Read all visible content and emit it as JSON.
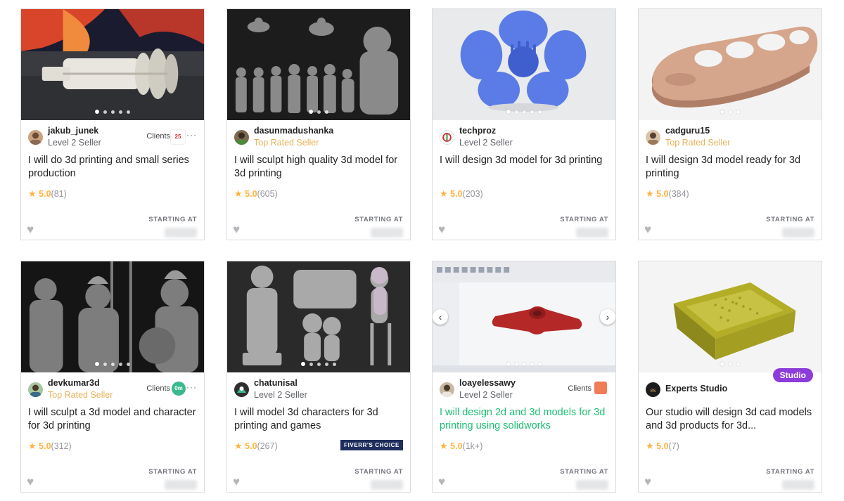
{
  "gigs": [
    {
      "seller": "jakub_junek",
      "level": "Level 2 Seller",
      "level_type": "regular",
      "clients_label": "Clients",
      "client_logo": "25",
      "title": "I will do 3d printing and small series production",
      "score": "5.0",
      "count": "(81)",
      "starting": "STARTING AT",
      "image": "jet-engine-model",
      "dots": 5
    },
    {
      "seller": "dasunmadushanka",
      "level": "Top Rated Seller",
      "level_type": "top",
      "title": "I will sculpt high quality 3d model for 3d printing",
      "score": "5.0",
      "count": "(605)",
      "starting": "STARTING AT",
      "image": "superhero-figurines",
      "dots": 3
    },
    {
      "seller": "techproz",
      "level": "Level 2 Seller",
      "level_type": "regular",
      "title": "I will design 3d model for 3d printing",
      "score": "5.0",
      "count": "(203)",
      "starting": "STARTING AT",
      "image": "blue-flower-model",
      "dots": 5
    },
    {
      "seller": "cadguru15",
      "level": "Top Rated Seller",
      "level_type": "top",
      "title": "I will design 3d model ready for 3d printing",
      "score": "5.0",
      "count": "(384)",
      "starting": "STARTING AT",
      "image": "brass-knuckles-model",
      "dots": 3
    },
    {
      "seller": "devkumar3d",
      "level": "Top Rated Seller",
      "level_type": "top",
      "clients_label": "Clients",
      "client_logo": "0m",
      "title": "I will sculpt a 3d model and character for 3d printing",
      "score": "5.0",
      "count": "(312)",
      "starting": "STARTING AT",
      "image": "warrior-sculptures",
      "dots": 5
    },
    {
      "seller": "chatunisal",
      "level": "Level 2 Seller",
      "level_type": "regular",
      "title": "I will model 3d characters for 3d printing and games",
      "score": "5.0",
      "count": "(267)",
      "starting": "STARTING AT",
      "badge": "FIVERR'S CHOICE",
      "image": "character-figurines",
      "dots": 5
    },
    {
      "seller": "loayelessawy",
      "level": "Level 2 Seller",
      "level_type": "regular",
      "clients_label": "Clients",
      "title": "I will design 2d and 3d models for 3d printing using solidworks",
      "title_highlight": true,
      "score": "5.0",
      "count": "(1k+)",
      "starting": "STARTING AT",
      "image": "solidworks-screenshot",
      "dots": 5
    },
    {
      "seller": "Experts Studio",
      "level": "",
      "level_type": "none",
      "studio_label": "Studio",
      "title": "Our studio will design 3d cad models and 3d products for 3d...",
      "score": "5.0",
      "count": "(7)",
      "starting": "STARTING AT",
      "image": "green-tray-model",
      "dots": 3
    }
  ],
  "colors": {
    "accent": "#1dbf73",
    "star": "#ffb33e",
    "top_rated": "#e8b15a",
    "studio": "#8c3cd9"
  }
}
